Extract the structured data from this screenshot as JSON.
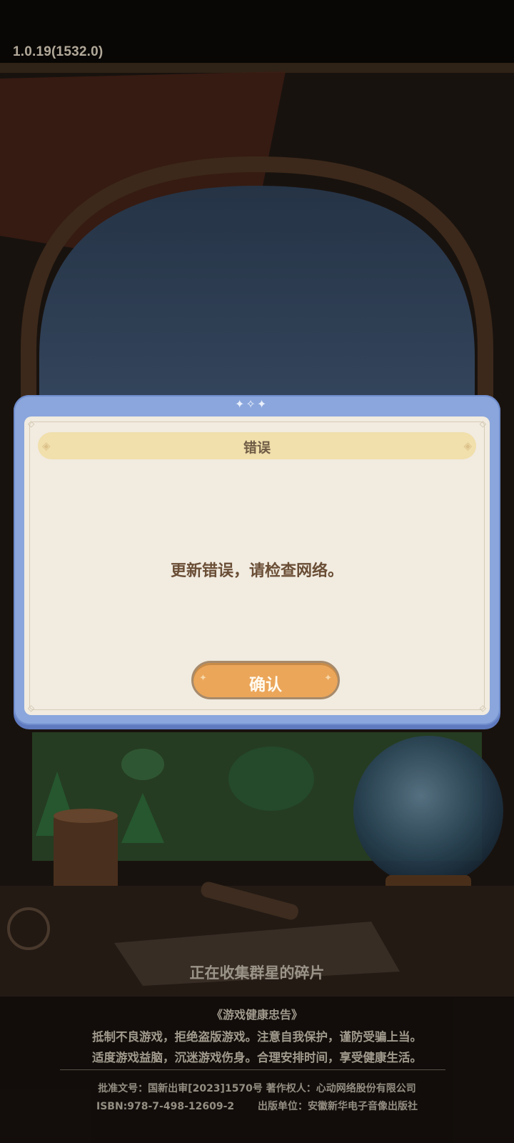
{
  "version_label": "1.0.19(1532.0)",
  "loading_text": "正在收集群星的碎片",
  "advisory": {
    "title": "《游戏健康忠告》",
    "line1": "抵制不良游戏，拒绝盗版游戏。注意自我保护，谨防受骗上当。",
    "line2": "适度游戏益脑，沉迷游戏伤身。合理安排时间，享受健康生活。"
  },
  "credits": {
    "line1": "批准文号：国新出审[2023]1570号 著作权人：心动网络股份有限公司",
    "isbn": "ISBN:978-7-498-12609-2",
    "publisher": "出版单位：安徽新华电子音像出版社"
  },
  "dialog": {
    "title": "错误",
    "message": "更新错误，请检查网络。",
    "confirm_label": "确认"
  },
  "colors": {
    "dialog_frame": "#8aa6dc",
    "dialog_body": "#f1ebe0",
    "title_bar": "#f1dfac",
    "confirm_button": "#eba65a",
    "text_brown": "#6a4e36"
  }
}
